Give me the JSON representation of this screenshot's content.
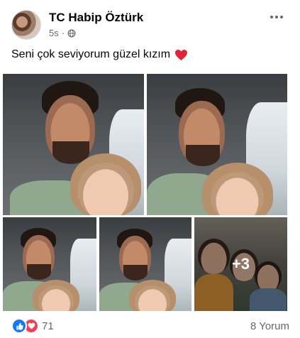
{
  "post": {
    "author": "TC Habip Öztürk",
    "time": "5s",
    "separator": "·",
    "privacy_icon": "globe-icon",
    "more_icon": "more-options-icon",
    "text": "Seni çok seviyorum güzel kızım",
    "text_emoji": "heart-icon"
  },
  "photos": {
    "extra_count": "+3"
  },
  "footer": {
    "reaction_icons": [
      "like-icon",
      "love-icon"
    ],
    "reaction_count": "71",
    "comments": "8 Yorum"
  },
  "colors": {
    "like": "#1877f2",
    "love": "#f33e58",
    "secondary_text": "#65676b"
  }
}
